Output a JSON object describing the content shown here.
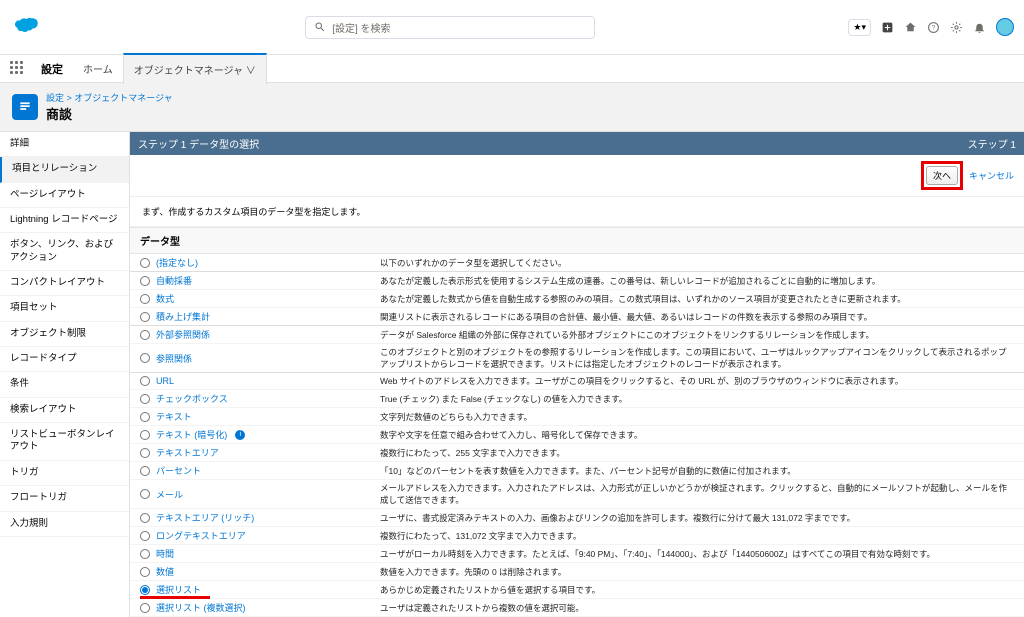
{
  "topbar": {
    "search_placeholder": "[設定] を検索"
  },
  "nav": {
    "title": "設定",
    "tabs": [
      {
        "label": "ホーム",
        "active": false
      },
      {
        "label": "オブジェクトマネージャ ∨",
        "active": true
      }
    ]
  },
  "page_header": {
    "breadcrumb_prefix": "設定 >",
    "breadcrumb_link": "オブジェクトマネージャ",
    "title": "商談"
  },
  "sidebar": {
    "items": [
      {
        "label": "詳細",
        "active": false
      },
      {
        "label": "項目とリレーション",
        "active": true
      },
      {
        "label": "ページレイアウト",
        "active": false
      },
      {
        "label": "Lightning レコードページ",
        "active": false
      },
      {
        "label": "ボタン、リンク、およびアクション",
        "active": false
      },
      {
        "label": "コンパクトレイアウト",
        "active": false
      },
      {
        "label": "項目セット",
        "active": false
      },
      {
        "label": "オブジェクト制限",
        "active": false
      },
      {
        "label": "レコードタイプ",
        "active": false
      },
      {
        "label": "条件",
        "active": false
      },
      {
        "label": "検索レイアウト",
        "active": false
      },
      {
        "label": "リストビューボタンレイアウト",
        "active": false
      },
      {
        "label": "トリガ",
        "active": false
      },
      {
        "label": "フロートリガ",
        "active": false
      },
      {
        "label": "入力規則",
        "active": false
      }
    ]
  },
  "step": {
    "left": "ステップ 1 データ型の選択",
    "right": "ステップ 1"
  },
  "buttons": {
    "next": "次へ",
    "cancel": "キャンセル"
  },
  "intro": "まず、作成するカスタム項目のデータ型を指定します。",
  "section": {
    "head": "データ型",
    "none": {
      "label": "(指定なし)",
      "desc": "以下のいずれかのデータ型を選択してください。"
    },
    "options": [
      {
        "label": "自動採番",
        "desc": "あなたが定義した表示形式を使用するシステム生成の連番。この番号は、新しいレコードが追加されるごとに自動的に増加します。",
        "group_first": true
      },
      {
        "label": "数式",
        "desc": "あなたが定義した数式から値を自動生成する参照のみの項目。この数式項目は、いずれかのソース項目が変更されたときに更新されます。"
      },
      {
        "label": "積み上げ集計",
        "desc": "関連リストに表示されるレコードにある項目の合計値、最小値、最大値、あるいはレコードの件数を表示する参照のみ項目です。",
        "group_last": true
      },
      {
        "label": "外部参照関係",
        "desc": "データが Salesforce 組織の外部に保存されている外部オブジェクトにこのオブジェクトをリンクするリレーションを作成します。",
        "group_first": true
      },
      {
        "label": "参照関係",
        "desc": "このオブジェクトと別のオブジェクトをの参照するリレーションを作成します。この項目において、ユーザはルックアップアイコンをクリックして表示されるポップアップリストからレコードを選択できます。リストには指定したオブジェクトのレコードが表示されます。",
        "group_last": true
      },
      {
        "label": "URL",
        "desc": "Web サイトのアドレスを入力できます。ユーザがこの項目をクリックすると、その URL が、別のブラウザのウィンドウに表示されます。",
        "group_first": true
      },
      {
        "label": "チェックボックス",
        "desc": "True (チェック) また False (チェックなし) の値を入力できます。"
      },
      {
        "label": "テキスト",
        "desc": "文字列だ数値のどちらも入力できます。"
      },
      {
        "label": "テキスト (暗号化)",
        "desc": "数字や文字を任意で組み合わせて入力し、暗号化して保存できます。",
        "info": true
      },
      {
        "label": "テキストエリア",
        "desc": "複数行にわたって、255 文字まで入力できます。"
      },
      {
        "label": "パーセント",
        "desc": "「10」などのパーセントを表す数値を入力できます。また、パーセント記号が自動的に数値に付加されます。"
      },
      {
        "label": "メール",
        "desc": "メールアドレスを入力できます。入力されたアドレスは、入力形式が正しいかどうかが検証されます。クリックすると、自動的にメールソフトが起動し、メールを作成して送信できます。"
      },
      {
        "label": "テキストエリア (リッチ)",
        "desc": "ユーザに、書式設定済みテキストの入力、画像およびリンクの追加を許可します。複数行に分けて最大 131,072 字までです。"
      },
      {
        "label": "ロングテキストエリア",
        "desc": "複数行にわたって、131,072 文字まで入力できます。"
      },
      {
        "label": "時間",
        "desc": "ユーザがローカル時刻を入力できます。たとえば、「9:40 PM」、「7:40」、「144000」、および「144050600Z」はすべてこの項目で有効な時刻です。"
      },
      {
        "label": "数値",
        "desc": "数値を入力できます。先頭の 0 は削除されます。"
      },
      {
        "label": "選択リスト",
        "desc": "あらかじめ定義されたリストから値を選択する項目です。",
        "selected": true,
        "underline": true
      },
      {
        "label": "選択リスト (複数選択)",
        "desc": "ユーザは定義されたリストから複数の値を選択可能。"
      }
    ]
  }
}
